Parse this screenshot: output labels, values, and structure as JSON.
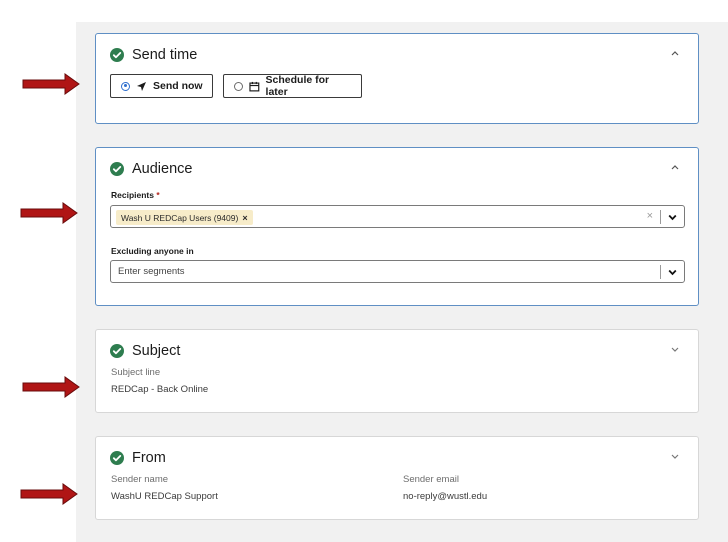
{
  "colors": {
    "accent_green": "#2e7d4f",
    "focus_border": "#5f8fc4",
    "arrow_red": "#b01515",
    "chip_bg": "#f7ecc9",
    "required_star": "#b3261e"
  },
  "send_time": {
    "title": "Send time",
    "status_icon": "check-circle-icon",
    "expanded": true,
    "options": [
      {
        "label": "Send now",
        "icon": "paper-plane-icon",
        "selected": true
      },
      {
        "label": "Schedule for later",
        "icon": "calendar-icon",
        "selected": false
      }
    ]
  },
  "audience": {
    "title": "Audience",
    "status_icon": "check-circle-icon",
    "expanded": true,
    "recipients_label": "Recipients",
    "required_marker": "*",
    "recipients_chip": "Wash U REDCap Users (9409)",
    "chip_remove": "×",
    "clear_symbol": "×",
    "excluding_label": "Excluding anyone in",
    "excluding_placeholder": "Enter segments"
  },
  "subject": {
    "title": "Subject",
    "status_icon": "check-circle-icon",
    "expanded": false,
    "subject_line_label": "Subject line",
    "subject_line_value": "REDCap - Back Online"
  },
  "from": {
    "title": "From",
    "status_icon": "check-circle-icon",
    "expanded": false,
    "sender_name_label": "Sender name",
    "sender_name_value": "WashU REDCap Support",
    "sender_email_label": "Sender email",
    "sender_email_value": "no-reply@wustl.edu"
  },
  "annotation_arrows": [
    "send-time",
    "recipients",
    "subject",
    "from"
  ]
}
